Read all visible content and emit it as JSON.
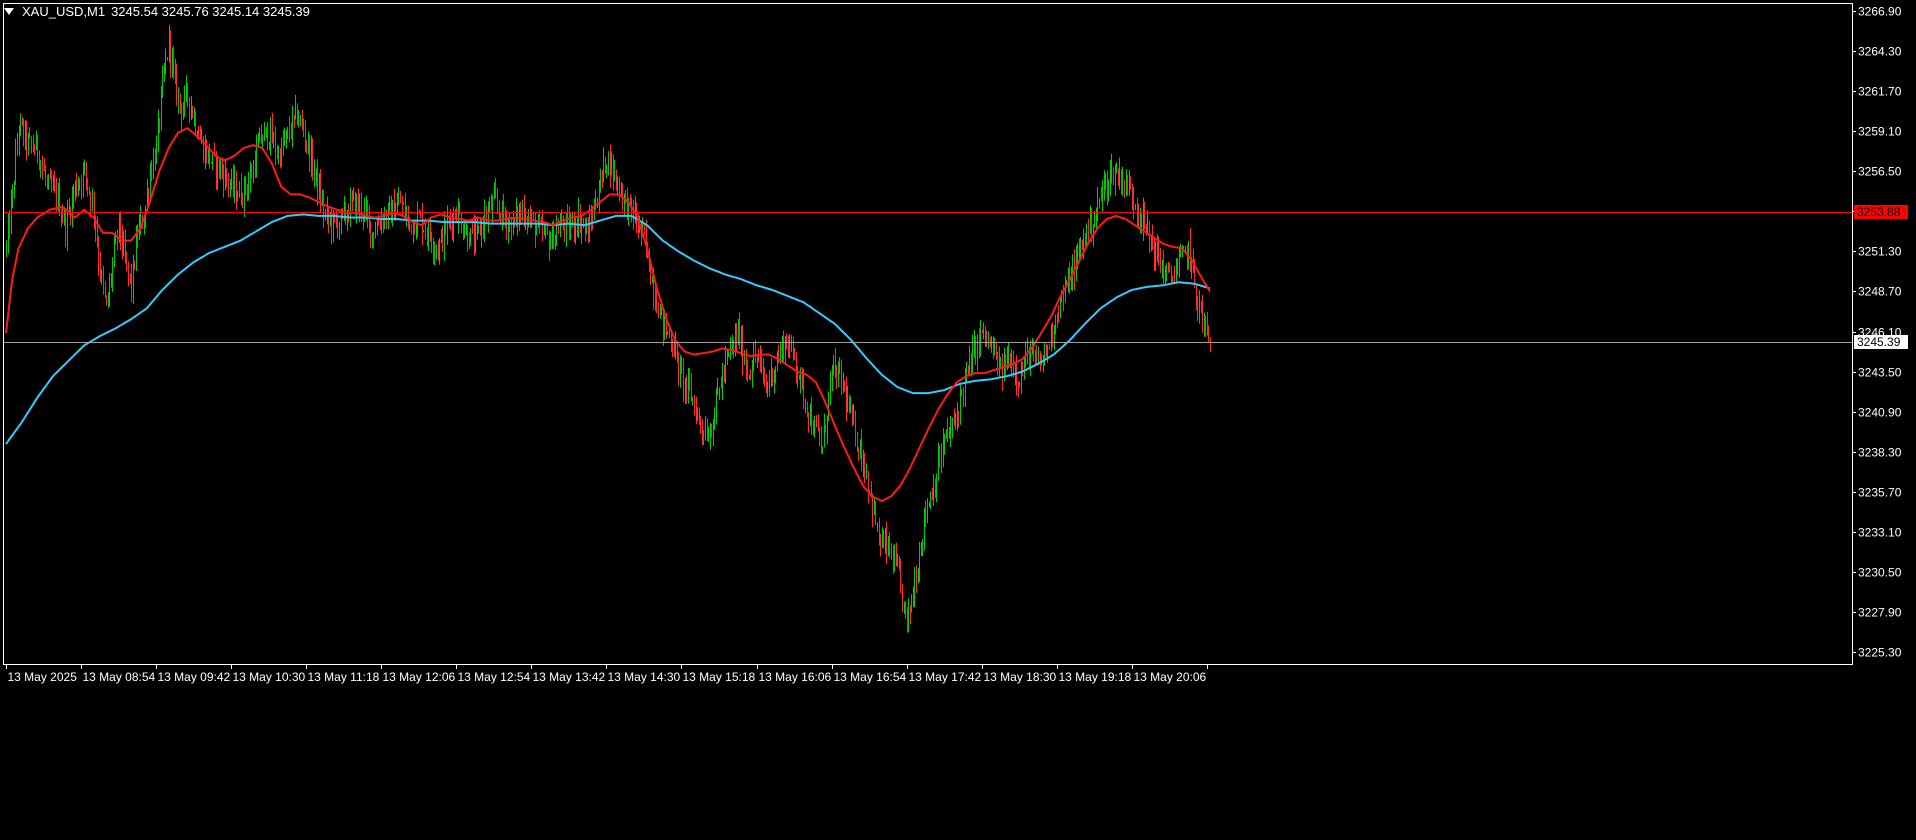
{
  "header": {
    "symbol": "XAU_USD,M1",
    "ohlc": "3245.54 3245.76 3245.14 3245.39"
  },
  "colors": {
    "background": "#000000",
    "axis": "#ffffff",
    "candle_up": "#00cc00",
    "candle_down": "#ff2a2a",
    "ma_fast": "#ff1a1a",
    "ma_slow": "#33ccff",
    "level_line": "#ff0000",
    "bid_line": "#a0a0a0"
  },
  "chart_data": {
    "type": "candlestick",
    "title": "XAU_USD,M1",
    "ylim": [
      3224.0,
      3268.0
    ],
    "y_ticks": [
      3266.9,
      3264.3,
      3261.7,
      3259.1,
      3256.5,
      3253.9,
      3251.3,
      3248.7,
      3246.1,
      3243.5,
      3240.9,
      3238.3,
      3235.7,
      3233.1,
      3230.5,
      3227.9,
      3225.3
    ],
    "y_tick_labels": [
      "3266.90",
      "3264.30",
      "3261.70",
      "3259.10",
      "3256.50",
      "3253.90",
      "3251.30",
      "3248.70",
      "3246.10",
      "3243.50",
      "3240.90",
      "3238.30",
      "3235.70",
      "3233.10",
      "3230.50",
      "3227.90",
      "3225.30"
    ],
    "x_range_minutes": [
      0,
      770
    ],
    "x_tick_minutes": [
      0,
      48,
      96,
      144,
      192,
      240,
      288,
      336,
      384,
      432,
      480,
      528,
      576,
      624,
      672,
      720,
      768
    ],
    "x_tick_labels": [
      "13 May 2025",
      "13 May 08:54",
      "13 May 09:42",
      "13 May 10:30",
      "13 May 11:18",
      "13 May 12:06",
      "13 May 12:54",
      "13 May 13:42",
      "13 May 14:30",
      "13 May 15:18",
      "13 May 16:06",
      "13 May 16:54",
      "13 May 17:42",
      "13 May 18:30",
      "13 May 19:18",
      "13 May 20:06"
    ],
    "x_tick_label_offset": 1,
    "price_path": [
      [
        0,
        3251.5
      ],
      [
        4,
        3255.0
      ],
      [
        8,
        3259.5
      ],
      [
        14,
        3258.2
      ],
      [
        20,
        3258.0
      ],
      [
        26,
        3255.5
      ],
      [
        32,
        3255.0
      ],
      [
        38,
        3253.0
      ],
      [
        44,
        3255.5
      ],
      [
        50,
        3256.5
      ],
      [
        56,
        3254.0
      ],
      [
        60,
        3250.0
      ],
      [
        64,
        3247.5
      ],
      [
        68,
        3250.5
      ],
      [
        72,
        3253.0
      ],
      [
        76,
        3250.5
      ],
      [
        80,
        3249.0
      ],
      [
        84,
        3252.5
      ],
      [
        88,
        3253.5
      ],
      [
        92,
        3256.5
      ],
      [
        96,
        3258.0
      ],
      [
        100,
        3262.0
      ],
      [
        104,
        3265.0
      ],
      [
        108,
        3262.0
      ],
      [
        112,
        3260.5
      ],
      [
        116,
        3261.5
      ],
      [
        120,
        3260.0
      ],
      [
        126,
        3258.0
      ],
      [
        132,
        3257.0
      ],
      [
        138,
        3256.5
      ],
      [
        144,
        3255.5
      ],
      [
        150,
        3255.0
      ],
      [
        156,
        3256.0
      ],
      [
        162,
        3258.5
      ],
      [
        168,
        3259.0
      ],
      [
        174,
        3257.5
      ],
      [
        180,
        3258.8
      ],
      [
        186,
        3260.2
      ],
      [
        192,
        3258.5
      ],
      [
        198,
        3256.0
      ],
      [
        204,
        3253.5
      ],
      [
        210,
        3253.0
      ],
      [
        216,
        3253.5
      ],
      [
        222,
        3254.5
      ],
      [
        228,
        3254.0
      ],
      [
        234,
        3252.5
      ],
      [
        240,
        3253.5
      ],
      [
        246,
        3253.8
      ],
      [
        252,
        3254.5
      ],
      [
        258,
        3253.0
      ],
      [
        264,
        3253.5
      ],
      [
        270,
        3252.5
      ],
      [
        276,
        3251.5
      ],
      [
        282,
        3253.0
      ],
      [
        288,
        3254.0
      ],
      [
        294,
        3252.5
      ],
      [
        300,
        3252.0
      ],
      [
        306,
        3253.5
      ],
      [
        312,
        3254.5
      ],
      [
        318,
        3253.5
      ],
      [
        324,
        3253.0
      ],
      [
        330,
        3254.0
      ],
      [
        336,
        3253.2
      ],
      [
        342,
        3252.5
      ],
      [
        348,
        3252.0
      ],
      [
        354,
        3253.0
      ],
      [
        360,
        3252.8
      ],
      [
        366,
        3253.5
      ],
      [
        372,
        3252.5
      ],
      [
        378,
        3255.0
      ],
      [
        384,
        3257.5
      ],
      [
        390,
        3256.0
      ],
      [
        396,
        3254.5
      ],
      [
        402,
        3253.5
      ],
      [
        408,
        3252.0
      ],
      [
        414,
        3249.0
      ],
      [
        420,
        3246.5
      ],
      [
        426,
        3245.5
      ],
      [
        432,
        3243.0
      ],
      [
        438,
        3242.0
      ],
      [
        444,
        3240.0
      ],
      [
        450,
        3239.5
      ],
      [
        456,
        3242.5
      ],
      [
        462,
        3244.5
      ],
      [
        468,
        3246.0
      ],
      [
        474,
        3243.5
      ],
      [
        480,
        3244.5
      ],
      [
        486,
        3242.5
      ],
      [
        492,
        3244.0
      ],
      [
        498,
        3245.5
      ],
      [
        504,
        3244.5
      ],
      [
        510,
        3242.0
      ],
      [
        516,
        3240.0
      ],
      [
        522,
        3238.5
      ],
      [
        528,
        3243.5
      ],
      [
        534,
        3243.0
      ],
      [
        540,
        3240.5
      ],
      [
        546,
        3238.5
      ],
      [
        552,
        3236.0
      ],
      [
        558,
        3232.5
      ],
      [
        564,
        3232.0
      ],
      [
        570,
        3230.5
      ],
      [
        576,
        3227.0
      ],
      [
        582,
        3230.5
      ],
      [
        588,
        3234.5
      ],
      [
        594,
        3236.5
      ],
      [
        600,
        3239.0
      ],
      [
        606,
        3240.0
      ],
      [
        612,
        3242.5
      ],
      [
        618,
        3244.5
      ],
      [
        624,
        3246.0
      ],
      [
        630,
        3245.0
      ],
      [
        636,
        3243.5
      ],
      [
        642,
        3244.5
      ],
      [
        648,
        3243.0
      ],
      [
        654,
        3244.8
      ],
      [
        660,
        3243.8
      ],
      [
        666,
        3245.0
      ],
      [
        672,
        3247.5
      ],
      [
        678,
        3249.0
      ],
      [
        684,
        3250.5
      ],
      [
        690,
        3252.5
      ],
      [
        696,
        3253.5
      ],
      [
        702,
        3255.5
      ],
      [
        708,
        3256.5
      ],
      [
        714,
        3256.0
      ],
      [
        720,
        3255.0
      ],
      [
        726,
        3253.5
      ],
      [
        732,
        3252.0
      ],
      [
        738,
        3250.5
      ],
      [
        744,
        3249.5
      ],
      [
        750,
        3250.5
      ],
      [
        756,
        3251.5
      ],
      [
        762,
        3248.0
      ],
      [
        766,
        3246.5
      ],
      [
        770,
        3245.4
      ]
    ],
    "ma_fast": [
      [
        0,
        3246.0
      ],
      [
        4,
        3249.5
      ],
      [
        8,
        3251.5
      ],
      [
        14,
        3252.8
      ],
      [
        20,
        3253.5
      ],
      [
        28,
        3254.0
      ],
      [
        36,
        3254.2
      ],
      [
        44,
        3253.5
      ],
      [
        50,
        3254.0
      ],
      [
        56,
        3253.5
      ],
      [
        62,
        3252.5
      ],
      [
        68,
        3252.5
      ],
      [
        74,
        3252.0
      ],
      [
        80,
        3252.0
      ],
      [
        86,
        3252.8
      ],
      [
        92,
        3254.5
      ],
      [
        98,
        3256.5
      ],
      [
        104,
        3258.0
      ],
      [
        110,
        3259.0
      ],
      [
        116,
        3259.3
      ],
      [
        122,
        3258.8
      ],
      [
        128,
        3258.2
      ],
      [
        134,
        3257.5
      ],
      [
        140,
        3257.2
      ],
      [
        146,
        3257.5
      ],
      [
        152,
        3258.0
      ],
      [
        158,
        3258.2
      ],
      [
        164,
        3258.0
      ],
      [
        170,
        3257.0
      ],
      [
        176,
        3255.5
      ],
      [
        182,
        3255.0
      ],
      [
        188,
        3255.0
      ],
      [
        194,
        3254.8
      ],
      [
        200,
        3254.5
      ],
      [
        206,
        3254.2
      ],
      [
        212,
        3254.0
      ],
      [
        218,
        3253.8
      ],
      [
        224,
        3253.8
      ],
      [
        230,
        3253.6
      ],
      [
        236,
        3253.5
      ],
      [
        242,
        3253.6
      ],
      [
        248,
        3253.8
      ],
      [
        254,
        3253.6
      ],
      [
        260,
        3253.2
      ],
      [
        266,
        3253.0
      ],
      [
        272,
        3253.5
      ],
      [
        278,
        3253.7
      ],
      [
        284,
        3253.5
      ],
      [
        290,
        3253.4
      ],
      [
        296,
        3253.3
      ],
      [
        302,
        3253.5
      ],
      [
        308,
        3253.3
      ],
      [
        314,
        3253.3
      ],
      [
        320,
        3253.4
      ],
      [
        326,
        3253.5
      ],
      [
        332,
        3253.4
      ],
      [
        338,
        3253.3
      ],
      [
        344,
        3253.2
      ],
      [
        350,
        3253.0
      ],
      [
        356,
        3253.3
      ],
      [
        362,
        3253.5
      ],
      [
        368,
        3253.6
      ],
      [
        374,
        3254.0
      ],
      [
        380,
        3254.5
      ],
      [
        386,
        3255.0
      ],
      [
        392,
        3255.0
      ],
      [
        398,
        3254.5
      ],
      [
        404,
        3253.5
      ],
      [
        410,
        3251.5
      ],
      [
        416,
        3249.0
      ],
      [
        422,
        3247.0
      ],
      [
        428,
        3245.5
      ],
      [
        434,
        3244.8
      ],
      [
        440,
        3244.6
      ],
      [
        446,
        3244.7
      ],
      [
        452,
        3244.8
      ],
      [
        458,
        3245.0
      ],
      [
        464,
        3244.9
      ],
      [
        470,
        3244.7
      ],
      [
        476,
        3244.5
      ],
      [
        482,
        3244.6
      ],
      [
        488,
        3244.6
      ],
      [
        494,
        3244.3
      ],
      [
        500,
        3243.9
      ],
      [
        506,
        3243.5
      ],
      [
        512,
        3243.3
      ],
      [
        518,
        3242.8
      ],
      [
        524,
        3241.5
      ],
      [
        530,
        3240.0
      ],
      [
        536,
        3238.6
      ],
      [
        542,
        3237.3
      ],
      [
        548,
        3236.1
      ],
      [
        554,
        3235.4
      ],
      [
        560,
        3235.1
      ],
      [
        566,
        3235.4
      ],
      [
        572,
        3236.1
      ],
      [
        578,
        3237.2
      ],
      [
        584,
        3238.5
      ],
      [
        590,
        3239.8
      ],
      [
        596,
        3241.0
      ],
      [
        602,
        3242.0
      ],
      [
        608,
        3242.8
      ],
      [
        614,
        3243.2
      ],
      [
        620,
        3243.4
      ],
      [
        626,
        3243.4
      ],
      [
        632,
        3243.6
      ],
      [
        638,
        3243.8
      ],
      [
        644,
        3244.0
      ],
      [
        650,
        3244.3
      ],
      [
        656,
        3245.0
      ],
      [
        662,
        3246.0
      ],
      [
        668,
        3247.0
      ],
      [
        674,
        3248.3
      ],
      [
        680,
        3249.4
      ],
      [
        686,
        3250.6
      ],
      [
        692,
        3251.8
      ],
      [
        698,
        3252.8
      ],
      [
        704,
        3253.4
      ],
      [
        710,
        3253.6
      ],
      [
        716,
        3253.4
      ],
      [
        722,
        3253.0
      ],
      [
        728,
        3252.6
      ],
      [
        734,
        3252.2
      ],
      [
        740,
        3251.8
      ],
      [
        746,
        3251.6
      ],
      [
        752,
        3251.5
      ],
      [
        758,
        3250.8
      ],
      [
        764,
        3249.7
      ],
      [
        770,
        3248.7
      ]
    ],
    "ma_slow": [
      [
        0,
        3238.8
      ],
      [
        10,
        3240.2
      ],
      [
        20,
        3241.8
      ],
      [
        30,
        3243.2
      ],
      [
        40,
        3244.2
      ],
      [
        50,
        3245.2
      ],
      [
        60,
        3245.8
      ],
      [
        70,
        3246.3
      ],
      [
        80,
        3246.9
      ],
      [
        90,
        3247.6
      ],
      [
        100,
        3248.8
      ],
      [
        110,
        3249.8
      ],
      [
        120,
        3250.6
      ],
      [
        130,
        3251.2
      ],
      [
        140,
        3251.6
      ],
      [
        150,
        3252.0
      ],
      [
        160,
        3252.6
      ],
      [
        170,
        3253.2
      ],
      [
        180,
        3253.6
      ],
      [
        190,
        3253.7
      ],
      [
        200,
        3253.6
      ],
      [
        210,
        3253.6
      ],
      [
        220,
        3253.5
      ],
      [
        230,
        3253.5
      ],
      [
        240,
        3253.4
      ],
      [
        250,
        3253.4
      ],
      [
        260,
        3253.3
      ],
      [
        270,
        3253.3
      ],
      [
        280,
        3253.2
      ],
      [
        290,
        3253.2
      ],
      [
        300,
        3253.2
      ],
      [
        310,
        3253.1
      ],
      [
        320,
        3253.1
      ],
      [
        330,
        3253.1
      ],
      [
        340,
        3253.1
      ],
      [
        350,
        3253.0
      ],
      [
        360,
        3253.1
      ],
      [
        370,
        3253.0
      ],
      [
        380,
        3253.3
      ],
      [
        390,
        3253.6
      ],
      [
        400,
        3253.6
      ],
      [
        410,
        3253.0
      ],
      [
        420,
        3252.0
      ],
      [
        430,
        3251.3
      ],
      [
        440,
        3250.7
      ],
      [
        450,
        3250.2
      ],
      [
        460,
        3249.8
      ],
      [
        470,
        3249.5
      ],
      [
        480,
        3249.1
      ],
      [
        490,
        3248.8
      ],
      [
        500,
        3248.4
      ],
      [
        510,
        3248.0
      ],
      [
        520,
        3247.3
      ],
      [
        530,
        3246.6
      ],
      [
        540,
        3245.6
      ],
      [
        550,
        3244.4
      ],
      [
        560,
        3243.3
      ],
      [
        570,
        3242.5
      ],
      [
        580,
        3242.1
      ],
      [
        590,
        3242.1
      ],
      [
        600,
        3242.3
      ],
      [
        610,
        3242.7
      ],
      [
        620,
        3242.9
      ],
      [
        630,
        3243.0
      ],
      [
        640,
        3243.2
      ],
      [
        650,
        3243.5
      ],
      [
        660,
        3244.0
      ],
      [
        670,
        3244.6
      ],
      [
        680,
        3245.5
      ],
      [
        690,
        3246.6
      ],
      [
        700,
        3247.6
      ],
      [
        710,
        3248.3
      ],
      [
        720,
        3248.8
      ],
      [
        730,
        3249.0
      ],
      [
        740,
        3249.1
      ],
      [
        750,
        3249.3
      ],
      [
        760,
        3249.2
      ],
      [
        770,
        3248.9
      ]
    ],
    "horizontal_levels": [
      {
        "value": 3253.88,
        "label": "3253.88",
        "kind": "level"
      },
      {
        "value": 3245.39,
        "label": "3245.39",
        "kind": "bid"
      }
    ]
  }
}
